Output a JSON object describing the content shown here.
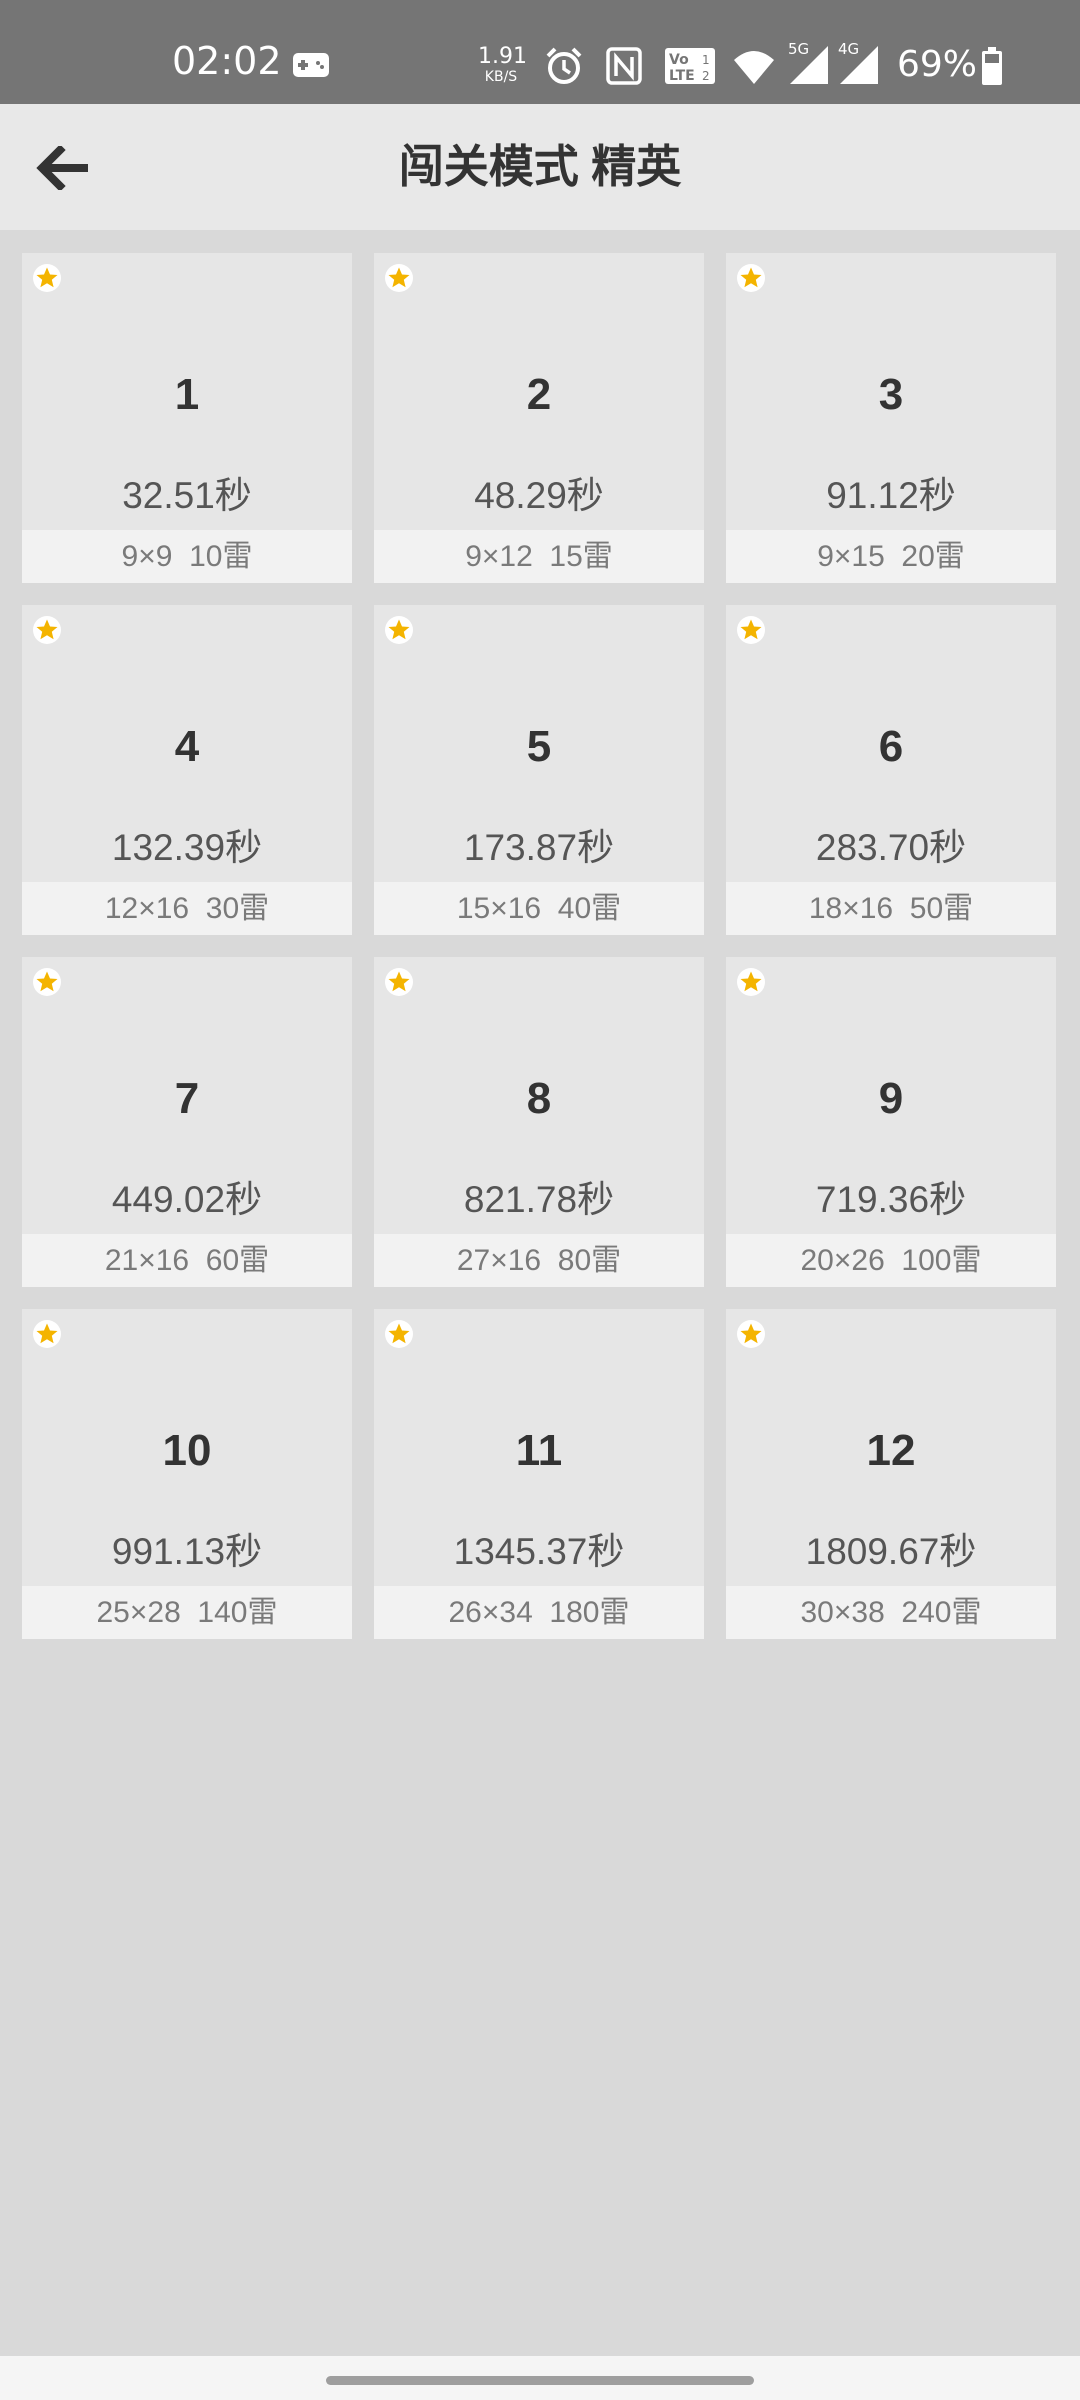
{
  "status_bar": {
    "time": "02:02",
    "net_speed_value": "1.91",
    "net_speed_unit": "KB/S",
    "signal_5g": "5G",
    "signal_4g": "4G",
    "battery_percent": "69%",
    "icons": [
      "game-controller-icon",
      "alarm-icon",
      "nfc-icon",
      "volte-icon",
      "wifi-icon",
      "signal-5g-icon",
      "signal-4g-icon",
      "battery-icon"
    ]
  },
  "header": {
    "title": "闯关模式 精英"
  },
  "colors": {
    "status_bar_bg": "#757575",
    "header_bg": "#e8e8e8",
    "page_bg": "#d9d9d9",
    "card_bg": "#e6e6e6",
    "card_info_bg": "#f2f2f2",
    "star": "#f4b400"
  },
  "levels": [
    {
      "number": "1",
      "time": "32.51秒",
      "info": "9×9  10雷"
    },
    {
      "number": "2",
      "time": "48.29秒",
      "info": "9×12  15雷"
    },
    {
      "number": "3",
      "time": "91.12秒",
      "info": "9×15  20雷"
    },
    {
      "number": "4",
      "time": "132.39秒",
      "info": "12×16  30雷"
    },
    {
      "number": "5",
      "time": "173.87秒",
      "info": "15×16  40雷"
    },
    {
      "number": "6",
      "time": "283.70秒",
      "info": "18×16  50雷"
    },
    {
      "number": "7",
      "time": "449.02秒",
      "info": "21×16  60雷"
    },
    {
      "number": "8",
      "time": "821.78秒",
      "info": "27×16  80雷"
    },
    {
      "number": "9",
      "time": "719.36秒",
      "info": "20×26  100雷"
    },
    {
      "number": "10",
      "time": "991.13秒",
      "info": "25×28  140雷"
    },
    {
      "number": "11",
      "time": "1345.37秒",
      "info": "26×34  180雷"
    },
    {
      "number": "12",
      "time": "1809.67秒",
      "info": "30×38  240雷"
    }
  ]
}
